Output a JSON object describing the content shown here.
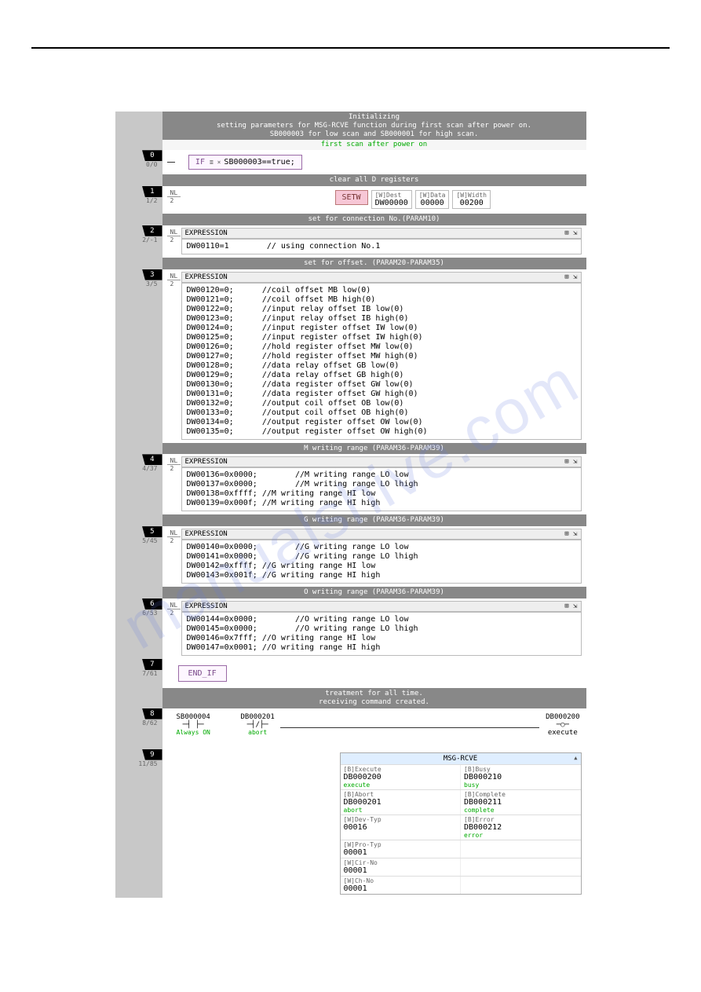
{
  "header": {
    "band1": "Initializing\nsetting parameters for MSG-RCVE function during first scan after power on.\nSB000003 for low scan and SB000001 for high scan.",
    "green1": "first scan after power on"
  },
  "rung0": {
    "num": "0",
    "sub": "0/0",
    "if_kw": "IF",
    "if_icon": "≣ ×",
    "if_expr": "SB000003==true;"
  },
  "band2": "clear all D registers",
  "rung1": {
    "num": "1",
    "sub": "1/2",
    "nl": "NL",
    "nl2": "2",
    "setw": "SETW",
    "dest_h": "[W]Dest",
    "dest_v": "DW00000",
    "data_h": "[W]Data",
    "data_v": "00000",
    "width_h": "[W]Width",
    "width_v": "00200"
  },
  "band3": "set for connection No.(PARAM10)",
  "rung2": {
    "num": "2",
    "sub": "2/-1",
    "nl": "NL",
    "nl2": "2",
    "expr_label": "EXPRESSION",
    "expr_icons": "⊞ ⇲",
    "code": "DW00110=1        // using connection No.1"
  },
  "band4": "set for offset. (PARAM20-PARAM35)",
  "rung3": {
    "num": "3",
    "sub": "3/5",
    "nl": "NL",
    "nl2": "2",
    "expr_label": "EXPRESSION",
    "expr_icons": "⊞ ⇲",
    "code": "DW00120=0;      //coil offset MB low(0)\nDW00121=0;      //coil offset MB high(0)\nDW00122=0;      //input relay offset IB low(0)\nDW00123=0;      //input relay offset IB high(0)\nDW00124=0;      //input register offset IW low(0)\nDW00125=0;      //input register offset IW high(0)\nDW00126=0;      //hold register offset MW low(0)\nDW00127=0;      //hold register offset MW high(0)\nDW00128=0;      //data relay offset GB low(0)\nDW00129=0;      //data relay offset GB high(0)\nDW00130=0;      //data register offset GW low(0)\nDW00131=0;      //data register offset GW high(0)\nDW00132=0;      //output coil offset OB low(0)\nDW00133=0;      //output coil offset OB high(0)\nDW00134=0;      //output register offset OW low(0)\nDW00135=0;      //output register offset OW high(0)"
  },
  "band5": "M writing range (PARAM36-PARAM39)",
  "rung4": {
    "num": "4",
    "sub": "4/37",
    "nl": "NL",
    "nl2": "2",
    "expr_label": "EXPRESSION",
    "expr_icons": "⊞ ⇲",
    "code": "DW00136=0x0000;        //M writing range LO low\nDW00137=0x0000;        //M writing range LO lhigh\nDW00138=0xffff; //M writing range HI low\nDW00139=0x000f; //M writing range HI high"
  },
  "band6": "G writing range (PARAM36-PARAM39)",
  "rung5": {
    "num": "5",
    "sub": "5/45",
    "nl": "NL",
    "nl2": "2",
    "expr_label": "EXPRESSION",
    "expr_icons": "⊞ ⇲",
    "code": "DW00140=0x0000;        //G writing range LO low\nDW00141=0x0000;        //G writing range LO lhigh\nDW00142=0xffff; //G writing range HI low\nDW00143=0x001f; //G writing range HI high"
  },
  "band7": "O writing range (PARAM36-PARAM39)",
  "rung6": {
    "num": "6",
    "sub": "6/53",
    "nl": "NL",
    "nl2": "2",
    "expr_label": "EXPRESSION",
    "expr_icons": "⊞ ⇲",
    "code": "DW00144=0x0000;        //O writing range LO low\nDW00145=0x0000;        //O writing range LO lhigh\nDW00146=0x7fff; //O writing range HI low\nDW00147=0x0001; //O writing range HI high"
  },
  "rung7": {
    "num": "7",
    "sub": "7/61",
    "endif": "END_IF"
  },
  "band8": "treatment for all time.\nreceiving command created.",
  "rung8": {
    "num": "8",
    "sub": "8/62",
    "c1_addr": "SB000004",
    "c1_lbl": "Always ON",
    "c2_addr": "DB000201",
    "c2_sym": "├/┤",
    "c2_lbl": "abort",
    "coil_addr": "DB000200",
    "coil_lbl": "execute"
  },
  "rung9": {
    "num": "9",
    "sub": "11/85"
  },
  "fb": {
    "title": "MSG-RCVE",
    "tri": "▲",
    "r1a_t": "[B]Execute",
    "r1a_v": "DB000200",
    "r1a_g": "execute",
    "r1b_t": "[B]Busy",
    "r1b_v": "DB000210",
    "r1b_g": "busy",
    "r2a_t": "[B]Abort",
    "r2a_v": "DB000201",
    "r2a_g": "abort",
    "r2b_t": "[B]Complete",
    "r2b_v": "DB000211",
    "r2b_g": "complete",
    "r3a_t": "[W]Dev-Typ",
    "r3a_v": "00016",
    "r3b_t": "[B]Error",
    "r3b_v": "DB000212",
    "r3b_g": "error",
    "r4a_t": "[W]Pro-Typ",
    "r4a_v": "00001",
    "r5a_t": "[W]Cir-No",
    "r5a_v": "00001",
    "r6a_t": "[W]Ch-No",
    "r6a_v": "00001"
  },
  "watermark": "manualshive.com"
}
